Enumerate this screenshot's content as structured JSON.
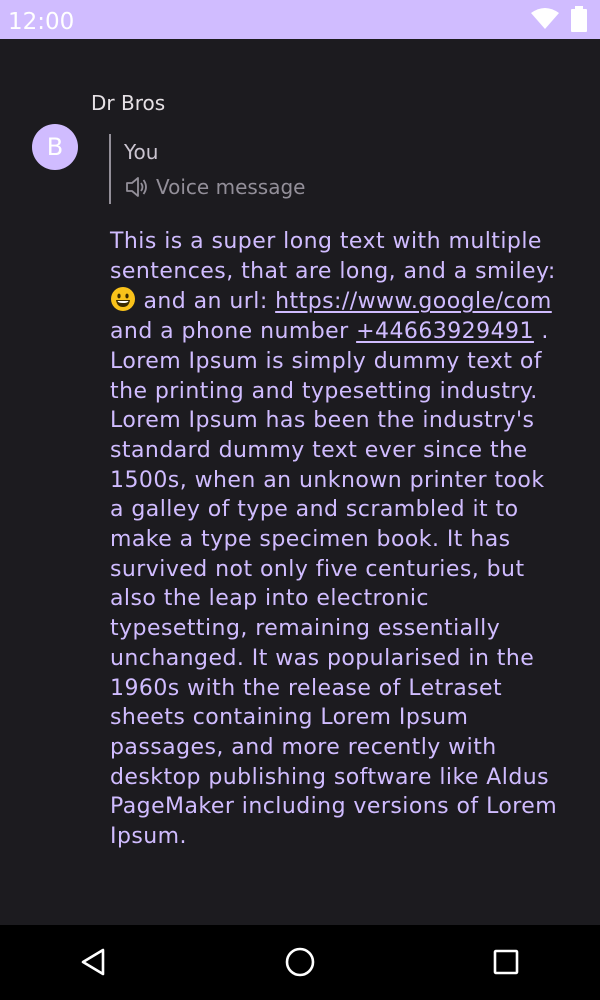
{
  "status_bar": {
    "time": "12:00",
    "icons": [
      "wifi-icon",
      "battery-icon"
    ],
    "background_color": "#d0bcff"
  },
  "conversation": {
    "sender_name": "Dr Bros",
    "avatar_initial": "B",
    "avatar_color": "#d0bcff"
  },
  "reply": {
    "author": "You",
    "preview_icon": "speaker-icon",
    "preview_text": "Voice message"
  },
  "message": {
    "text_part1": "This is a super long text with multiple sentences, that are long, and a smiley: ",
    "smiley_icon": "grinning-face-icon",
    "text_part2": " and an url: ",
    "url": "https://www.google/com",
    "text_part3": " and a phone number ",
    "phone": "+44663929491",
    "text_part4": " . Lorem Ipsum is simply dummy text of the printing and typesetting industry. Lorem Ipsum has been the industry's standard dummy text ever since the 1500s, when an unknown printer took a galley of type and scrambled it to make a type specimen book. It has survived not only five centuries, but also the leap into electronic typesetting, remaining essentially unchanged. It was popularised in the 1960s with the release of Letraset sheets containing Lorem Ipsum passages, and more recently with desktop publishing software like Aldus PageMaker including versions of Lorem Ipsum.",
    "text_color": "#d0bcff"
  },
  "navigation_bar": {
    "buttons": [
      "back-icon",
      "home-icon",
      "recents-icon"
    ]
  }
}
